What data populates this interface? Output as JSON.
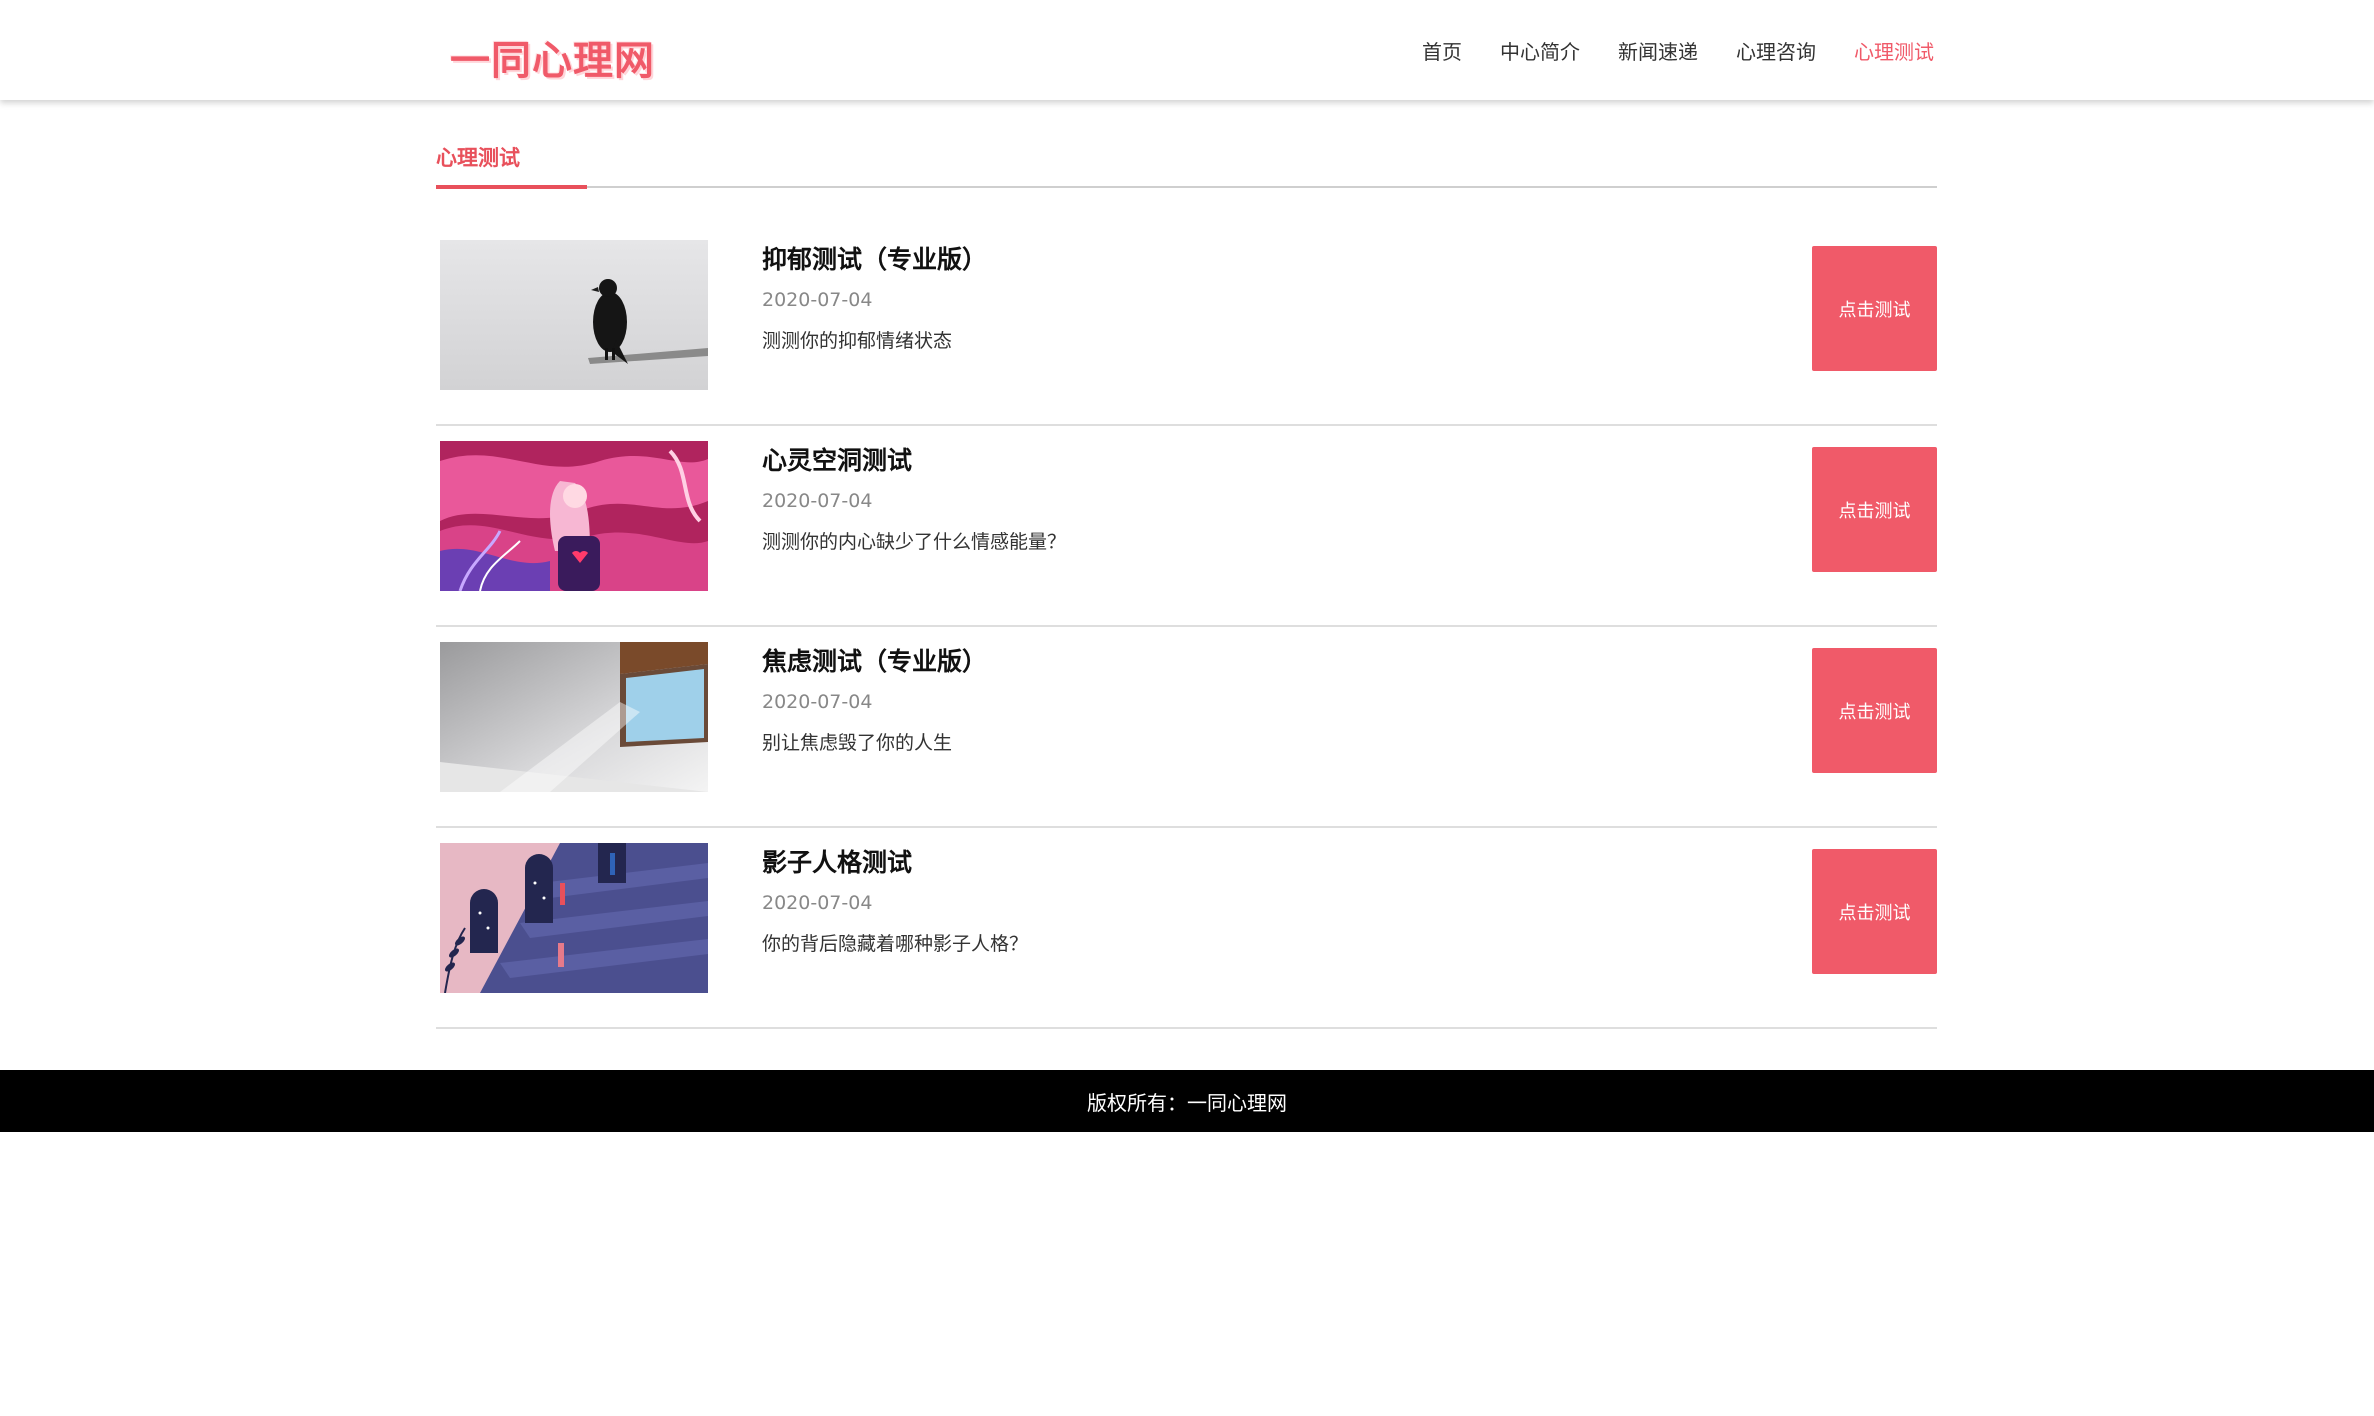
{
  "header": {
    "logo": "一同心理网",
    "nav": [
      {
        "label": "首页",
        "active": false
      },
      {
        "label": "中心简介",
        "active": false
      },
      {
        "label": "新闻速递",
        "active": false
      },
      {
        "label": "心理咨询",
        "active": false
      },
      {
        "label": "心理测试",
        "active": true
      }
    ]
  },
  "section": {
    "title": "心理测试"
  },
  "tests": [
    {
      "title": "抑郁测试（专业版）",
      "date": "2020-07-04",
      "description": "测测你的抑郁情绪状态",
      "button": "点击测试",
      "thumbnail": "crow-on-branch"
    },
    {
      "title": "心灵空洞测试",
      "date": "2020-07-04",
      "description": "测测你的内心缺少了什么情感能量？",
      "button": "点击测试",
      "thumbnail": "girl-pink-illustration"
    },
    {
      "title": "焦虑测试（专业版）",
      "date": "2020-07-04",
      "description": "别让焦虑毁了你的人生",
      "button": "点击测试",
      "thumbnail": "room-window-light"
    },
    {
      "title": "影子人格测试",
      "date": "2020-07-04",
      "description": "你的背后隐藏着哪种影子人格？",
      "button": "点击测试",
      "thumbnail": "doors-stairs-illustration"
    }
  ],
  "footer": {
    "copyright": "版权所有：一同心理网"
  },
  "colors": {
    "accent": "#f05a69",
    "footer_bg": "#000000"
  }
}
